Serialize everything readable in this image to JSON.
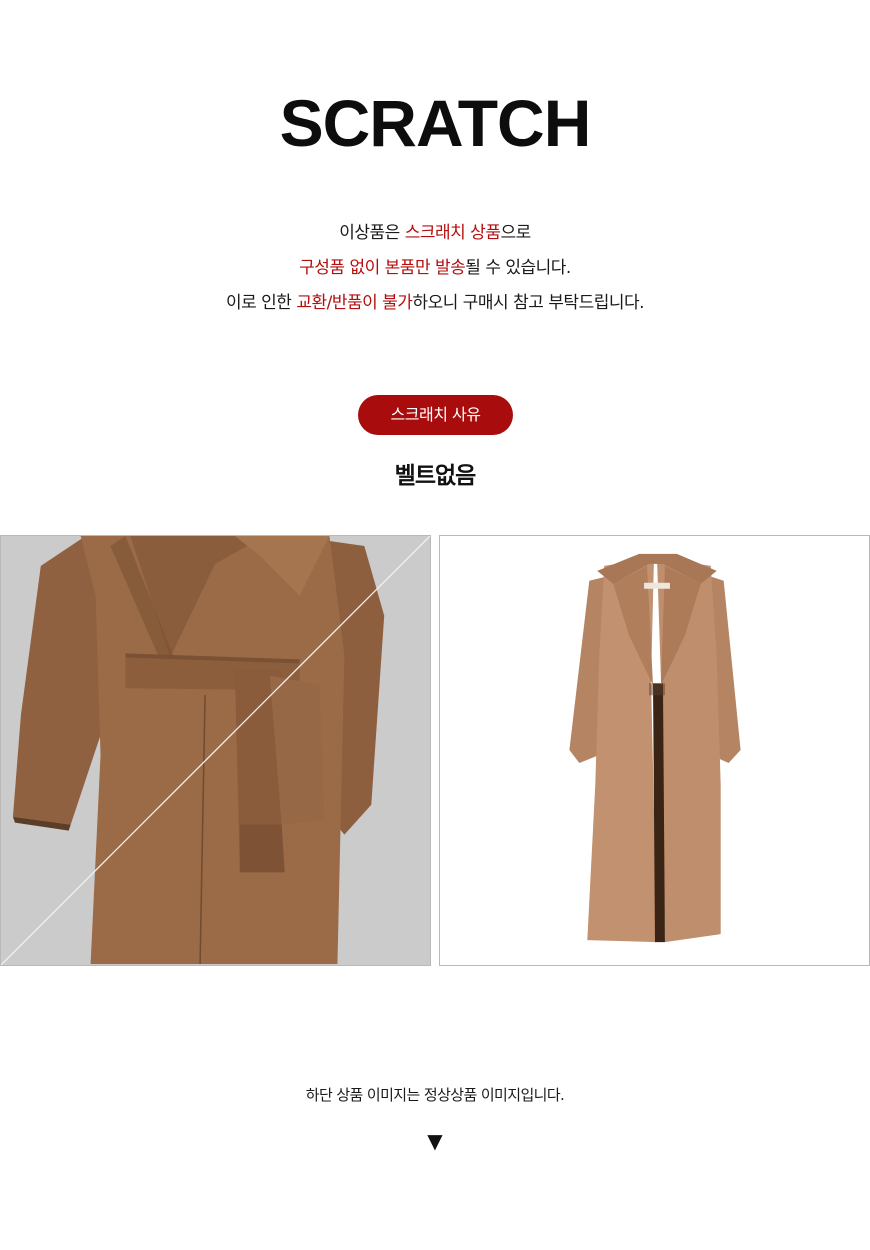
{
  "header": {
    "title": "SCRATCH"
  },
  "notice": {
    "line1": {
      "a": "이상품은 ",
      "b": "스크래치 상품",
      "c": "으로"
    },
    "line2": {
      "a": "구성품 없이 본품만 발송",
      "b": "될 수 있습니다."
    },
    "line3": {
      "a": "이로 인한 ",
      "b": "교환/반품이 불가",
      "c": "하오니 구매시 참고 부탁드립니다."
    }
  },
  "reason_badge": {
    "label": "스크래치 사유"
  },
  "reason_text": "벨트없음",
  "images": {
    "left": {
      "icon": "coat-closeup-image"
    },
    "right": {
      "icon": "coat-full-image"
    }
  },
  "footer": {
    "note": "하단 상품 이미지는 정상상품 이미지입니다.",
    "arrow": "▼"
  },
  "colors": {
    "accent": "#a80c0c",
    "highlight_text": "#b30f0f",
    "coat": "#9a6b45"
  }
}
